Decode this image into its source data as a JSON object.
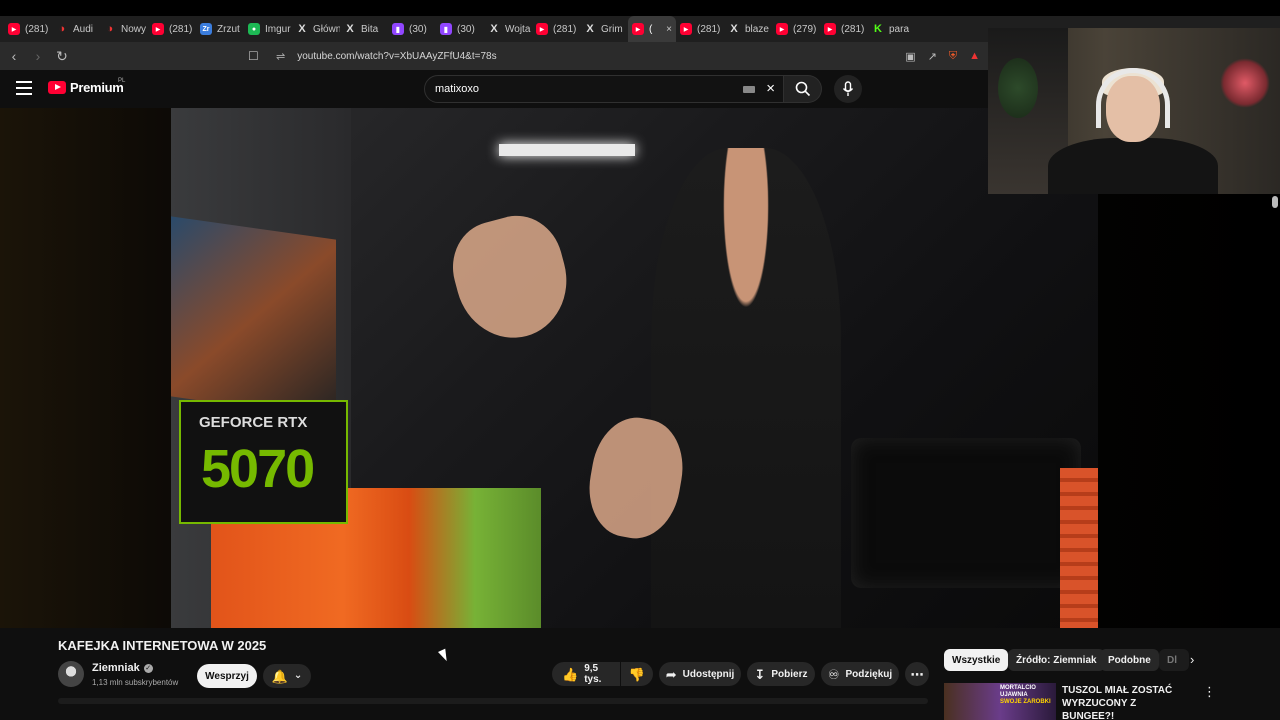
{
  "browser": {
    "tabs": [
      {
        "icon": "yt",
        "label": "(281)"
      },
      {
        "icon": "red",
        "label": "Audi"
      },
      {
        "icon": "red",
        "label": "Nowy"
      },
      {
        "icon": "yt",
        "label": "(281)"
      },
      {
        "icon": "blue",
        "label": "Zrzut"
      },
      {
        "icon": "green",
        "label": "Imgur"
      },
      {
        "icon": "x",
        "label": "Główna"
      },
      {
        "icon": "x",
        "label": "Bita"
      },
      {
        "icon": "twitch",
        "label": "(30)"
      },
      {
        "icon": "twitch",
        "label": "(30)"
      },
      {
        "icon": "x",
        "label": "Wojta"
      },
      {
        "icon": "yt",
        "label": "(281)"
      },
      {
        "icon": "x",
        "label": "Grim"
      },
      {
        "icon": "yt",
        "label": "(",
        "active": true
      },
      {
        "icon": "yt",
        "label": "(281)"
      },
      {
        "icon": "x",
        "label": "blaze"
      },
      {
        "icon": "yt",
        "label": "(279)"
      },
      {
        "icon": "yt",
        "label": "(281)"
      },
      {
        "icon": "kick",
        "label": "para"
      }
    ],
    "url": "youtube.com/watch?v=XbUAAyZFfU4&t=78s"
  },
  "youtube": {
    "logo_text": "Premium",
    "logo_country": "PL",
    "search_value": "matixoxo"
  },
  "video": {
    "title": "KAFEJKA INTERNETOWA W 2025",
    "box_text_line1": "GEFORCE RTX",
    "box_text_line2": "5070"
  },
  "channel": {
    "name": "Ziemniak",
    "subscribers": "1,13 mln subskrybentów",
    "support_label": "Wesprzyj"
  },
  "actions": {
    "likes": "9,5 tys.",
    "share_label": "Udostępnij",
    "download_label": "Pobierz",
    "thanks_label": "Podziękuj"
  },
  "chips": [
    "Wszystkie",
    "Źródło: Ziemniak",
    "Podobne",
    "Dl"
  ],
  "recommendation": {
    "title": "TUSZOL MIAŁ ZOSTAĆ WYRZUCONY Z BUNGEE?!",
    "thumb_line1": "MORTALCIO UJAWNIA",
    "thumb_line2": "SWOJE ZAROBKI"
  },
  "colors": {
    "yt_red": "#ff0033",
    "background": "#0f0f0f",
    "button_bg": "#272727",
    "nvidia_green": "#76b900"
  }
}
